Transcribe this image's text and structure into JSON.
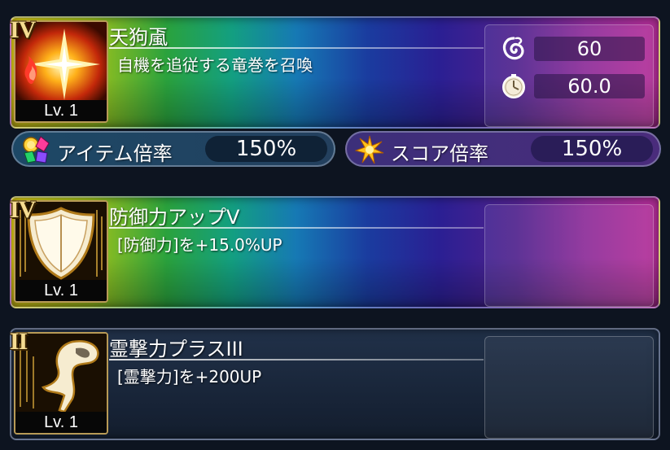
{
  "skills": [
    {
      "rank": "IV",
      "level": "Lv. 1",
      "name": "天狗颪",
      "description": "自機を追従する竜巻を召喚",
      "icon": "starburst-flame-icon",
      "stats": [
        {
          "icon": "spirit-swirl-icon",
          "value": "60"
        },
        {
          "icon": "clock-icon",
          "value": "60.0"
        }
      ]
    },
    {
      "rank": "IV",
      "level": "Lv. 1",
      "name": "防御力アップV",
      "description": "[防御力]を+15.0%UP",
      "icon": "shield-icon"
    },
    {
      "rank": "II",
      "level": "Lv. 1",
      "name": "霊撃力プラスIII",
      "description": "[霊撃力]を+200UP",
      "icon": "spirit-fist-icon"
    }
  ],
  "multipliers": {
    "item": {
      "label": "アイテム倍率",
      "value": "150%",
      "icon": "gems-icon"
    },
    "score": {
      "label": "スコア倍率",
      "value": "150%",
      "icon": "star-burst-icon"
    }
  }
}
